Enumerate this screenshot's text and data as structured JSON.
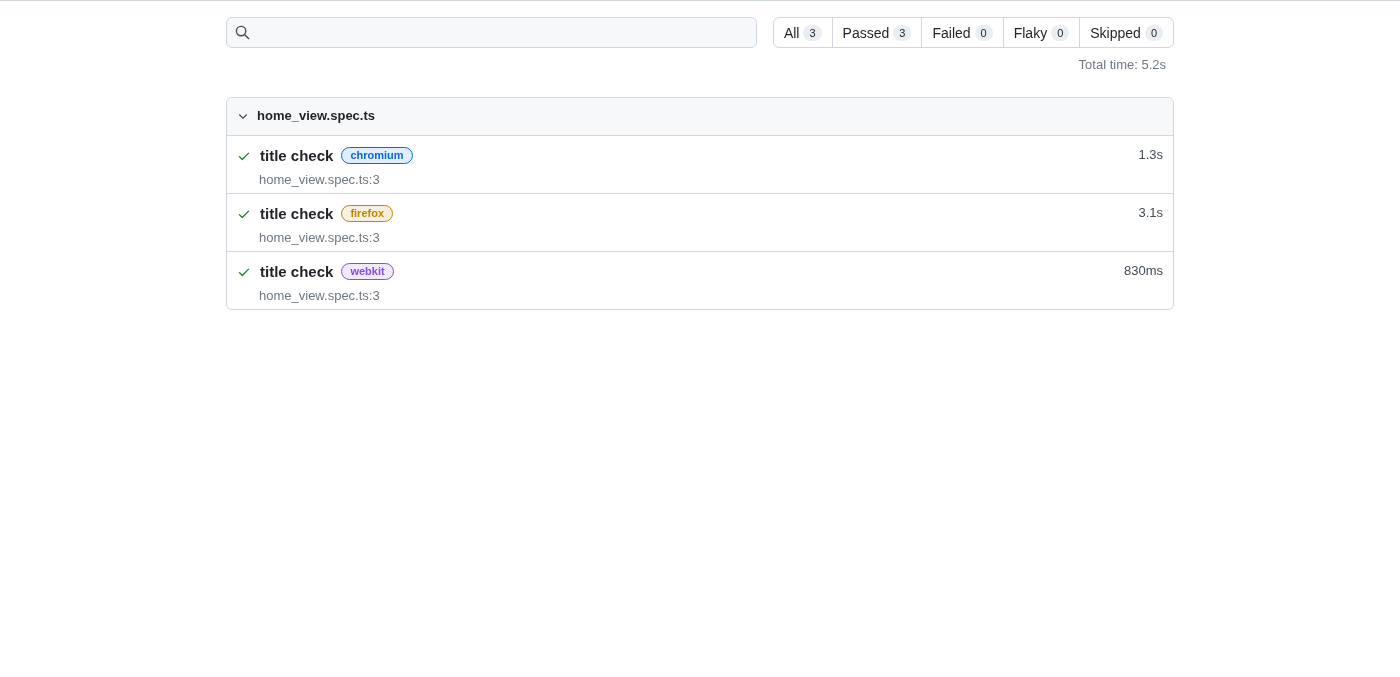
{
  "filters": [
    {
      "label": "All",
      "count": "3"
    },
    {
      "label": "Passed",
      "count": "3"
    },
    {
      "label": "Failed",
      "count": "0"
    },
    {
      "label": "Flaky",
      "count": "0"
    },
    {
      "label": "Skipped",
      "count": "0"
    }
  ],
  "total_time": "Total time: 5.2s",
  "file": {
    "name": "home_view.spec.ts",
    "expanded": true,
    "tests": [
      {
        "title": "title check",
        "kind": "passed",
        "project": {
          "label": "chromium",
          "color": "#0969da"
        },
        "location": "home_view.spec.ts:3",
        "duration": "1.3s"
      },
      {
        "title": "title check",
        "kind": "passed",
        "project": {
          "label": "firefox",
          "color": "#bf8700"
        },
        "location": "home_view.spec.ts:3",
        "duration": "3.1s"
      },
      {
        "title": "title check",
        "kind": "passed",
        "project": {
          "label": "webkit",
          "color": "#8250df"
        },
        "location": "home_view.spec.ts:3",
        "duration": "830ms"
      }
    ]
  }
}
